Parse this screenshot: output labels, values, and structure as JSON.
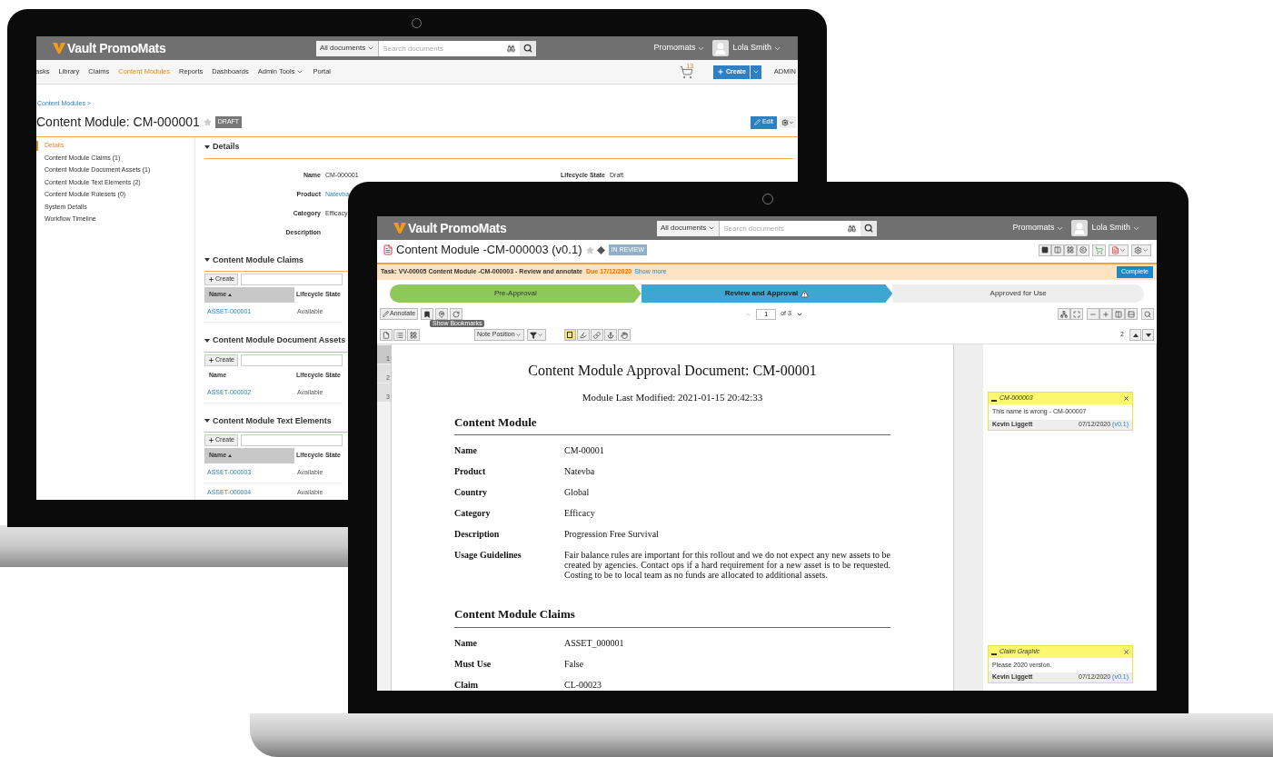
{
  "back_screen": {
    "header": {
      "logo": "Vault PromoMats",
      "scope": "All documents",
      "search_placeholder": "Search documents",
      "app": "Promomats",
      "user": "Lola Smith"
    },
    "nav": [
      {
        "label": "asks",
        "selected": false,
        "menu": false
      },
      {
        "label": "Library",
        "selected": false,
        "menu": false
      },
      {
        "label": "Claims",
        "selected": false,
        "menu": false
      },
      {
        "label": "Content Modules",
        "selected": true,
        "menu": false
      },
      {
        "label": "Reports",
        "selected": false,
        "menu": false
      },
      {
        "label": "Dashboards",
        "selected": false,
        "menu": false
      },
      {
        "label": "Admin Tools",
        "selected": false,
        "menu": true
      },
      {
        "label": "Portal",
        "selected": false,
        "menu": false
      }
    ],
    "cart_count": "13",
    "create": "Create",
    "admin": "ADMIN",
    "breadcrumb": "Content Modules >",
    "title": "Content Module: CM-000001",
    "status": "DRAFT",
    "edit": "Edit",
    "sidebar": [
      {
        "label": "Details",
        "selected": true
      },
      {
        "label": "Content Module Claims",
        "count": "(1)",
        "selected": false
      },
      {
        "label": "Content Module Document Assets",
        "count": "(1)",
        "selected": false
      },
      {
        "label": "Content Module Text Elements",
        "count": "(2)",
        "selected": false
      },
      {
        "label": "Content Module Rulesets",
        "count": "(0)",
        "selected": false
      },
      {
        "label": "System Details",
        "selected": false
      },
      {
        "label": "Workflow Timeline",
        "selected": false
      }
    ],
    "details": {
      "heading": "Details",
      "left_fields": [
        {
          "label": "Name",
          "value": "CM-000001",
          "link": false
        },
        {
          "label": "Product",
          "value": "Natevba",
          "link": true
        },
        {
          "label": "Category",
          "value": "Efficacy",
          "link": false
        },
        {
          "label": "Description"
        }
      ],
      "right_fields": [
        {
          "label": "Lifecycle State",
          "value": "Draft",
          "link": false
        }
      ]
    },
    "sections": [
      {
        "heading": "Content Module Claims",
        "create": "Create",
        "columns": [
          {
            "label": "Name",
            "sorted": true
          },
          {
            "label": "Lifecycle State",
            "sorted": false
          }
        ],
        "rows": [
          {
            "name": "ASSET-000001",
            "state": "Available"
          }
        ]
      },
      {
        "heading": "Content Module Document Assets",
        "create": "Create",
        "columns": [
          {
            "label": "Name",
            "sorted": false
          },
          {
            "label": "Lifecycle State",
            "sorted": false
          }
        ],
        "rows": [
          {
            "name": "ASSET-000002",
            "state": "Available"
          }
        ]
      },
      {
        "heading": "Content Module Text Elements",
        "create": "Create",
        "columns": [
          {
            "label": "Name",
            "sorted": true
          },
          {
            "label": "Lifecycle State",
            "sorted": false
          }
        ],
        "rows": [
          {
            "name": "ASSET-000003",
            "state": "Available"
          },
          {
            "name": "ASSET-000004",
            "state": "Available"
          }
        ]
      }
    ]
  },
  "front_screen": {
    "header": {
      "logo": "Vault PromoMats",
      "scope": "All documents",
      "search_placeholder": "Search documents",
      "app": "Promomats",
      "user": "Lola Smith"
    },
    "title": "Content Module -CM-000003 (v0.1)",
    "status": "IN REVIEW",
    "task": {
      "text": "Task: VV-00005 Content Module -CM-000003 - Review and annotate",
      "due": "Due 17/12/2020",
      "more": "Show more",
      "button": "Complete"
    },
    "stages": [
      {
        "label": "Pre-Approval",
        "kind": "done",
        "warning": false
      },
      {
        "label": "Review and Approval",
        "kind": "current",
        "warning": true
      },
      {
        "label": "Approved for Use",
        "kind": "todo",
        "warning": false
      }
    ],
    "viewer": {
      "annotate": "Annotate",
      "tooltip": "Show Bookmarks",
      "note_position": "Note Position",
      "page": "1",
      "of": "of 3",
      "note_count": "2"
    },
    "thumbnails": [
      {
        "label": "1",
        "selected": true
      },
      {
        "label": "2",
        "selected": false
      },
      {
        "label": "3",
        "selected": false
      }
    ],
    "document": {
      "title": "Content Module Approval Document: CM-00001",
      "subtitle": "Module Last Modified: 2021-01-15 20:42:33",
      "sections": [
        {
          "heading": "Content Module",
          "rows": [
            {
              "label": "Name",
              "value": "CM-00001"
            },
            {
              "label": "Product",
              "value": "Natevba"
            },
            {
              "label": "Country",
              "value": "Global"
            },
            {
              "label": "Category",
              "value": "Efficacy"
            },
            {
              "label": "Description",
              "value": "Progression Free Survival"
            },
            {
              "label": "Usage Guidelines",
              "value": "Fair balance rules are important for this rollout and we do not expect any new assets to be created by agencies. Contact ops if a hard requirement for a new asset is to be requested. Costing to be to local team as no funds are allocated to additional assets."
            }
          ]
        },
        {
          "heading": "Content Module Claims",
          "rows": [
            {
              "label": "Name",
              "value": "ASSET_000001"
            },
            {
              "label": "Must Use",
              "value": "False"
            },
            {
              "label": "Claim",
              "value": "CL-00023"
            }
          ]
        }
      ]
    },
    "annotations": [
      {
        "title": "CM-000003",
        "text": "This name is wrong - CM-000007",
        "author": "Kevin Liggett",
        "date": "07/12/2020",
        "version": "(v0.1)"
      },
      {
        "title": "Claim Graphic",
        "text": "Please 2020 version.",
        "author": "Kevin Liggett",
        "date": "07/12/2020",
        "version": "(v0.1)"
      }
    ]
  }
}
